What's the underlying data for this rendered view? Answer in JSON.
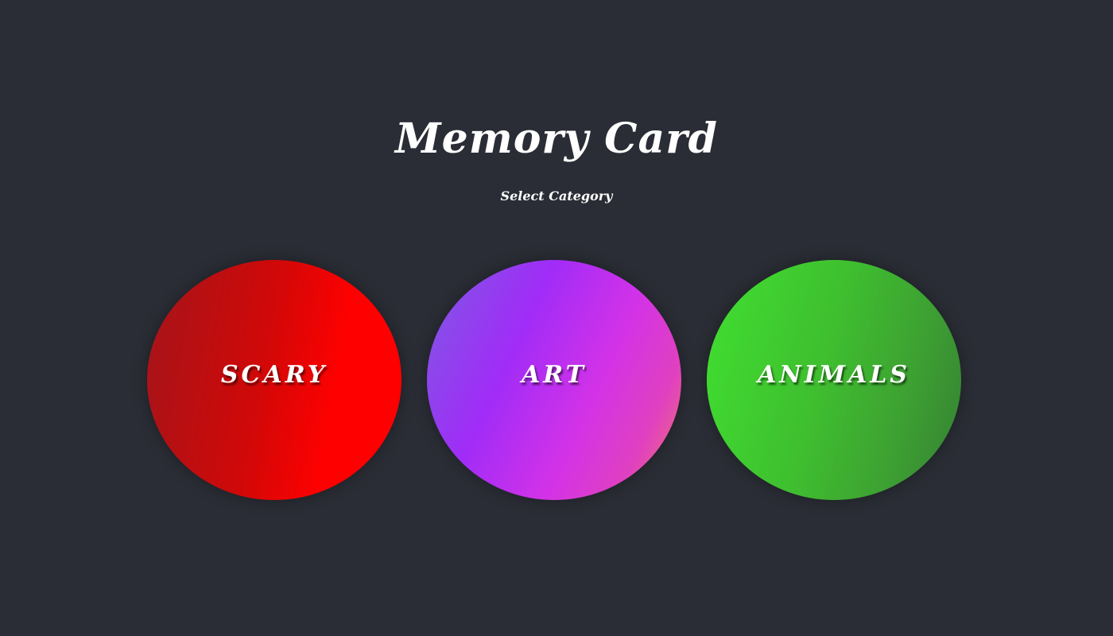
{
  "page": {
    "title": "Memory Card",
    "subtitle": "Select Category"
  },
  "categories": [
    {
      "label": "SCARY",
      "colors": [
        "#a3151a",
        "#ff0000"
      ]
    },
    {
      "label": "ART",
      "colors": [
        "#7d5ae3",
        "#a12cf7",
        "#d232e8",
        "#f27a6a"
      ]
    },
    {
      "label": "ANIMALS",
      "colors": [
        "#40e030",
        "#357f33"
      ]
    }
  ],
  "theme": {
    "background": "#2a2d35",
    "text": "#ffffff"
  }
}
